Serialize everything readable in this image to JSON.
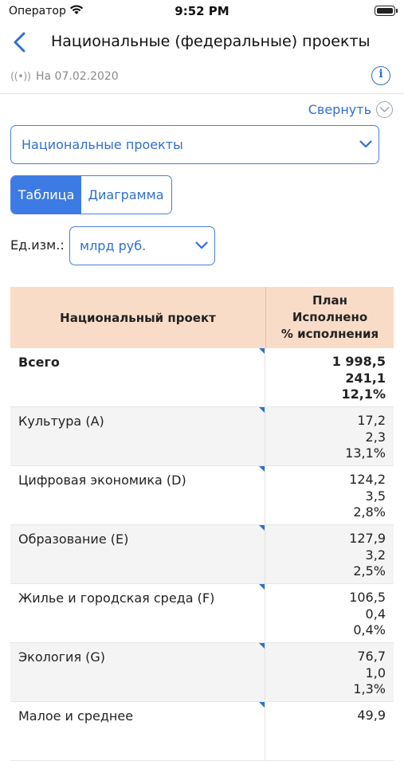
{
  "status_bar": {
    "carrier": "Оператор",
    "time": "9:52 PM"
  },
  "nav": {
    "title": "Национальные (федеральные) проекты"
  },
  "info": {
    "broadcast": "((•))",
    "date": "На 07.02.2020"
  },
  "collapse": {
    "label": "Свернуть"
  },
  "category_select": {
    "value": "Национальные проекты"
  },
  "view_tabs": {
    "table": "Таблица",
    "chart": "Диаграмма",
    "active": "table"
  },
  "unit": {
    "label": "Ед.изм.:",
    "value": "млрд руб."
  },
  "table": {
    "header": {
      "name": "Национальный проект",
      "plan": "План",
      "done": "Исполнено",
      "percent": "% исполнения"
    },
    "rows": [
      {
        "name": "Всего",
        "plan": "1 998,5",
        "done": "241,1",
        "percent": "12,1%"
      },
      {
        "name": "Культура (A)",
        "plan": "17,2",
        "done": "2,3",
        "percent": "13,1%"
      },
      {
        "name": "Цифровая экономика (D)",
        "plan": "124,2",
        "done": "3,5",
        "percent": "2,8%"
      },
      {
        "name": "Образование (E)",
        "plan": "127,9",
        "done": "3,2",
        "percent": "2,5%"
      },
      {
        "name": "Жилье и городская среда (F)",
        "plan": "106,5",
        "done": "0,4",
        "percent": "0,4%"
      },
      {
        "name": "Экология (G)",
        "plan": "76,7",
        "done": "1,0",
        "percent": "1,3%"
      },
      {
        "name": "Малое и среднее",
        "plan": "49,9",
        "done": "",
        "percent": ""
      }
    ]
  },
  "colors": {
    "accent": "#3c7be3",
    "header_bg": "#f9dcc8"
  }
}
